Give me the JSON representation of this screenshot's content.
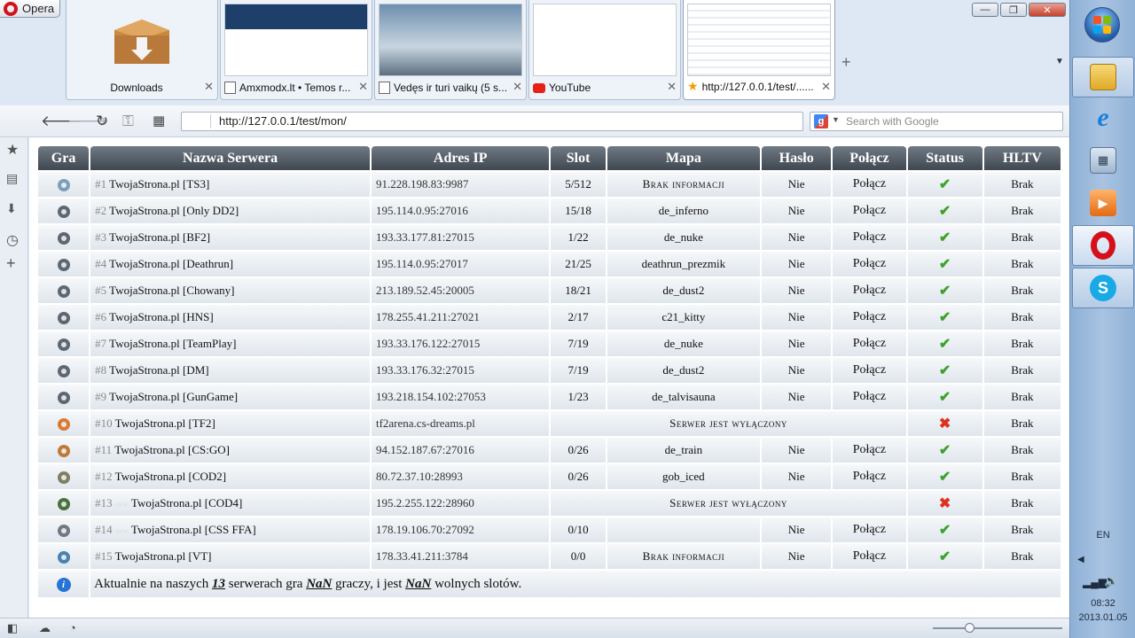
{
  "browser": {
    "menu_label": "Opera",
    "window_controls": {
      "minimize": "—",
      "restore": "❐",
      "close": "✕"
    },
    "tabs": [
      {
        "label": "Downloads",
        "close": "✕"
      },
      {
        "label": "Amxmodx.lt • Temos r...",
        "close": "✕"
      },
      {
        "label": "Vedęs ir turi vaikų (5 s...",
        "close": "✕"
      },
      {
        "label": "YouTube",
        "close": "✕"
      },
      {
        "label": "http://127.0.0.1/test/......",
        "close": "✕"
      }
    ],
    "new_tab": "+",
    "tab_menu": "▼",
    "url": "http://127.0.0.1/test/mon/",
    "search_placeholder": "Search with Google",
    "search_engine_letter": "g"
  },
  "sidebar": {
    "icons": [
      "star-icon",
      "notes-icon",
      "downloads-icon",
      "history-icon",
      "add-panel-icon"
    ]
  },
  "monitor": {
    "headers": [
      "Gra",
      "Nazwa Serwera",
      "Adres IP",
      "Slot",
      "Mapa",
      "Hasło",
      "Połącz",
      "Status",
      "HLTV"
    ],
    "rows": [
      {
        "num": "#1",
        "name": "TwojaStrona.pl [TS3]",
        "ip": "91.228.198.83:9987",
        "slot": "5/512",
        "map": "Brak informacji",
        "pass": "Nie",
        "connect": "Połącz",
        "status": "✔",
        "hltv": "Brak",
        "game_icon": "teamspeak-icon",
        "icon_color": "#6a8fb3"
      },
      {
        "num": "#2",
        "name": "TwojaStrona.pl [Only DD2]",
        "ip": "195.114.0.95:27016",
        "slot": "15/18",
        "map": "de_inferno",
        "pass": "Nie",
        "connect": "Połącz",
        "status": "✔",
        "hltv": "Brak",
        "game_icon": "counter-strike-icon",
        "icon_color": "#44505c"
      },
      {
        "num": "#3",
        "name": "TwojaStrona.pl [BF2]",
        "ip": "193.33.177.81:27015",
        "slot": "1/22",
        "map": "de_nuke",
        "pass": "Nie",
        "connect": "Połącz",
        "status": "✔",
        "hltv": "Brak",
        "game_icon": "counter-strike-icon",
        "icon_color": "#44505c"
      },
      {
        "num": "#4",
        "name": "TwojaStrona.pl [Deathrun]",
        "ip": "195.114.0.95:27017",
        "slot": "21/25",
        "map": "deathrun_prezmik",
        "pass": "Nie",
        "connect": "Połącz",
        "status": "✔",
        "hltv": "Brak",
        "game_icon": "counter-strike-icon",
        "icon_color": "#44505c"
      },
      {
        "num": "#5",
        "name": "TwojaStrona.pl [Chowany]",
        "ip": "213.189.52.45:20005",
        "slot": "18/21",
        "map": "de_dust2",
        "pass": "Nie",
        "connect": "Połącz",
        "status": "✔",
        "hltv": "Brak",
        "game_icon": "counter-strike-icon",
        "icon_color": "#44505c"
      },
      {
        "num": "#6",
        "name": "TwojaStrona.pl [HNS]",
        "ip": "178.255.41.211:27021",
        "slot": "2/17",
        "map": "c21_kitty",
        "pass": "Nie",
        "connect": "Połącz",
        "status": "✔",
        "hltv": "Brak",
        "game_icon": "counter-strike-icon",
        "icon_color": "#44505c"
      },
      {
        "num": "#7",
        "name": "TwojaStrona.pl [TeamPlay]",
        "ip": "193.33.176.122:27015",
        "slot": "7/19",
        "map": "de_nuke",
        "pass": "Nie",
        "connect": "Połącz",
        "status": "✔",
        "hltv": "Brak",
        "game_icon": "counter-strike-icon",
        "icon_color": "#44505c"
      },
      {
        "num": "#8",
        "name": "TwojaStrona.pl [DM]",
        "ip": "193.33.176.32:27015",
        "slot": "7/19",
        "map": "de_dust2",
        "pass": "Nie",
        "connect": "Połącz",
        "status": "✔",
        "hltv": "Brak",
        "game_icon": "counter-strike-icon",
        "icon_color": "#44505c"
      },
      {
        "num": "#9",
        "name": "TwojaStrona.pl [GunGame]",
        "ip": "193.218.154.102:27053",
        "slot": "1/23",
        "map": "de_talvisauna",
        "pass": "Nie",
        "connect": "Połącz",
        "status": "✔",
        "hltv": "Brak",
        "game_icon": "counter-strike-icon",
        "icon_color": "#44505c"
      },
      {
        "num": "#10",
        "name": "TwojaStrona.pl [TF2]",
        "ip": "tf2arena.cs-dreams.pl",
        "offline": "Serwer jest wyłączony",
        "status": "✖",
        "hltv": "Brak",
        "game_icon": "tf2-icon",
        "icon_color": "#d4661b"
      },
      {
        "num": "#11",
        "name": "TwojaStrona.pl [CS:GO]",
        "ip": "94.152.187.67:27016",
        "slot": "0/26",
        "map": "de_train",
        "pass": "Nie",
        "connect": "Połącz",
        "status": "✔",
        "hltv": "Brak",
        "game_icon": "csgo-icon",
        "icon_color": "#b5651d"
      },
      {
        "num": "#12",
        "name": "TwojaStrona.pl [COD2]",
        "ip": "80.72.37.10:28993",
        "slot": "0/26",
        "map": "gob_iced",
        "pass": "Nie",
        "connect": "Połącz",
        "status": "✔",
        "hltv": "Brak",
        "game_icon": "cod2-icon",
        "icon_color": "#6b6b4a"
      },
      {
        "num": "#13",
        "fade": "new",
        "name": "TwojaStrona.pl [COD4]",
        "ip": "195.2.255.122:28960",
        "offline": "Serwer jest wyłączony",
        "status": "✖",
        "hltv": "Brak",
        "game_icon": "cod4-icon",
        "icon_color": "#2d5a1e"
      },
      {
        "num": "#14",
        "fade": "new",
        "name": "TwojaStrona.pl [CSS FFA]",
        "ip": "178.19.106.70:27092",
        "slot": "0/10",
        "map": "",
        "pass": "Nie",
        "connect": "Połącz",
        "status": "✔",
        "hltv": "Brak",
        "game_icon": "css-icon",
        "icon_color": "#5b6470"
      },
      {
        "num": "#15",
        "name": "TwojaStrona.pl [VT]",
        "ip": "178.33.41.211:3784",
        "slot": "0/0",
        "map": "Brak informacji",
        "pass": "Nie",
        "connect": "Połącz",
        "status": "✔",
        "hltv": "Brak",
        "game_icon": "ventrilo-icon",
        "icon_color": "#2b6ea8"
      }
    ],
    "footer": {
      "info_glyph": "i",
      "part1": "Aktualnie na naszych ",
      "servers": "13",
      "part2": " serwerach gra ",
      "players": "NaN",
      "part3": " graczy, i jest ",
      "free": "NaN",
      "part4": " wolnych slotów."
    }
  },
  "taskbar": {
    "lang": "EN",
    "time": "08:32",
    "date": "2013.01.05"
  }
}
